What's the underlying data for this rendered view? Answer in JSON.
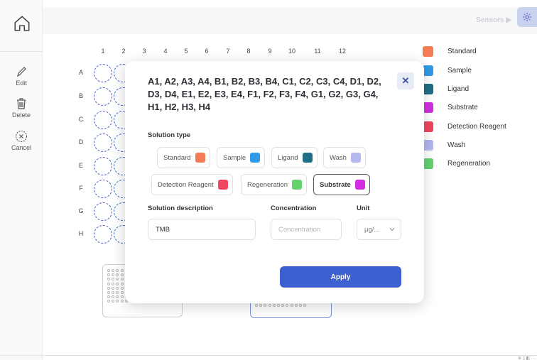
{
  "sidebar": {
    "tools": [
      {
        "label": "Edit",
        "icon": "pencil-icon"
      },
      {
        "label": "Delete",
        "icon": "trash-icon"
      },
      {
        "label": "Cancel",
        "icon": "cancel-circle-icon"
      }
    ]
  },
  "header": {
    "sensors_label": "Sensors ▶",
    "settings_icon": "gear-icon"
  },
  "plate": {
    "columns": [
      "1",
      "2",
      "3",
      "4",
      "5",
      "6",
      "7",
      "8",
      "9",
      "10",
      "11",
      "12"
    ],
    "rows": [
      "A",
      "B",
      "C",
      "D",
      "E",
      "F",
      "G",
      "H"
    ]
  },
  "legend": [
    {
      "label": "Standard",
      "color": "#f47c55"
    },
    {
      "label": "Sample",
      "color": "#2f9be9"
    },
    {
      "label": "Ligand",
      "color": "#1f6e86"
    },
    {
      "label": "Substrate",
      "color": "#d22fe3"
    },
    {
      "label": "Detection Reagent",
      "color": "#f1455f"
    },
    {
      "label": "Wash",
      "color": "#b3b8ef"
    },
    {
      "label": "Regeneration",
      "color": "#62d36d"
    }
  ],
  "modal": {
    "title": "A1, A2, A3, A4, B1, B2, B3, B4, C1, C2, C3, C4, D1, D2, D3, D4, E1, E2, E3, E4, F1, F2, F3, F4, G1, G2, G3, G4, H1, H2, H3, H4",
    "close_label": "✕",
    "solution_type_label": "Solution type",
    "chips": [
      {
        "label": "Standard",
        "color": "#f47c55"
      },
      {
        "label": "Sample",
        "color": "#2f9be9"
      },
      {
        "label": "Ligand",
        "color": "#1f6e86"
      },
      {
        "label": "Wash",
        "color": "#b3b8ef"
      },
      {
        "label": "Detection Reagent",
        "color": "#f1455f"
      },
      {
        "label": "Regeneration",
        "color": "#62d36d"
      },
      {
        "label": "Substrate",
        "color": "#d22fe3"
      }
    ],
    "selected_chip": "Substrate",
    "description_label": "Solution description",
    "description_value": "TMB",
    "concentration_label": "Concentration",
    "concentration_placeholder": "Concentration",
    "unit_label": "Unit",
    "unit_value": "μg/...",
    "apply_label": "Apply"
  },
  "colors": {
    "accent": "#3d5fcf"
  }
}
